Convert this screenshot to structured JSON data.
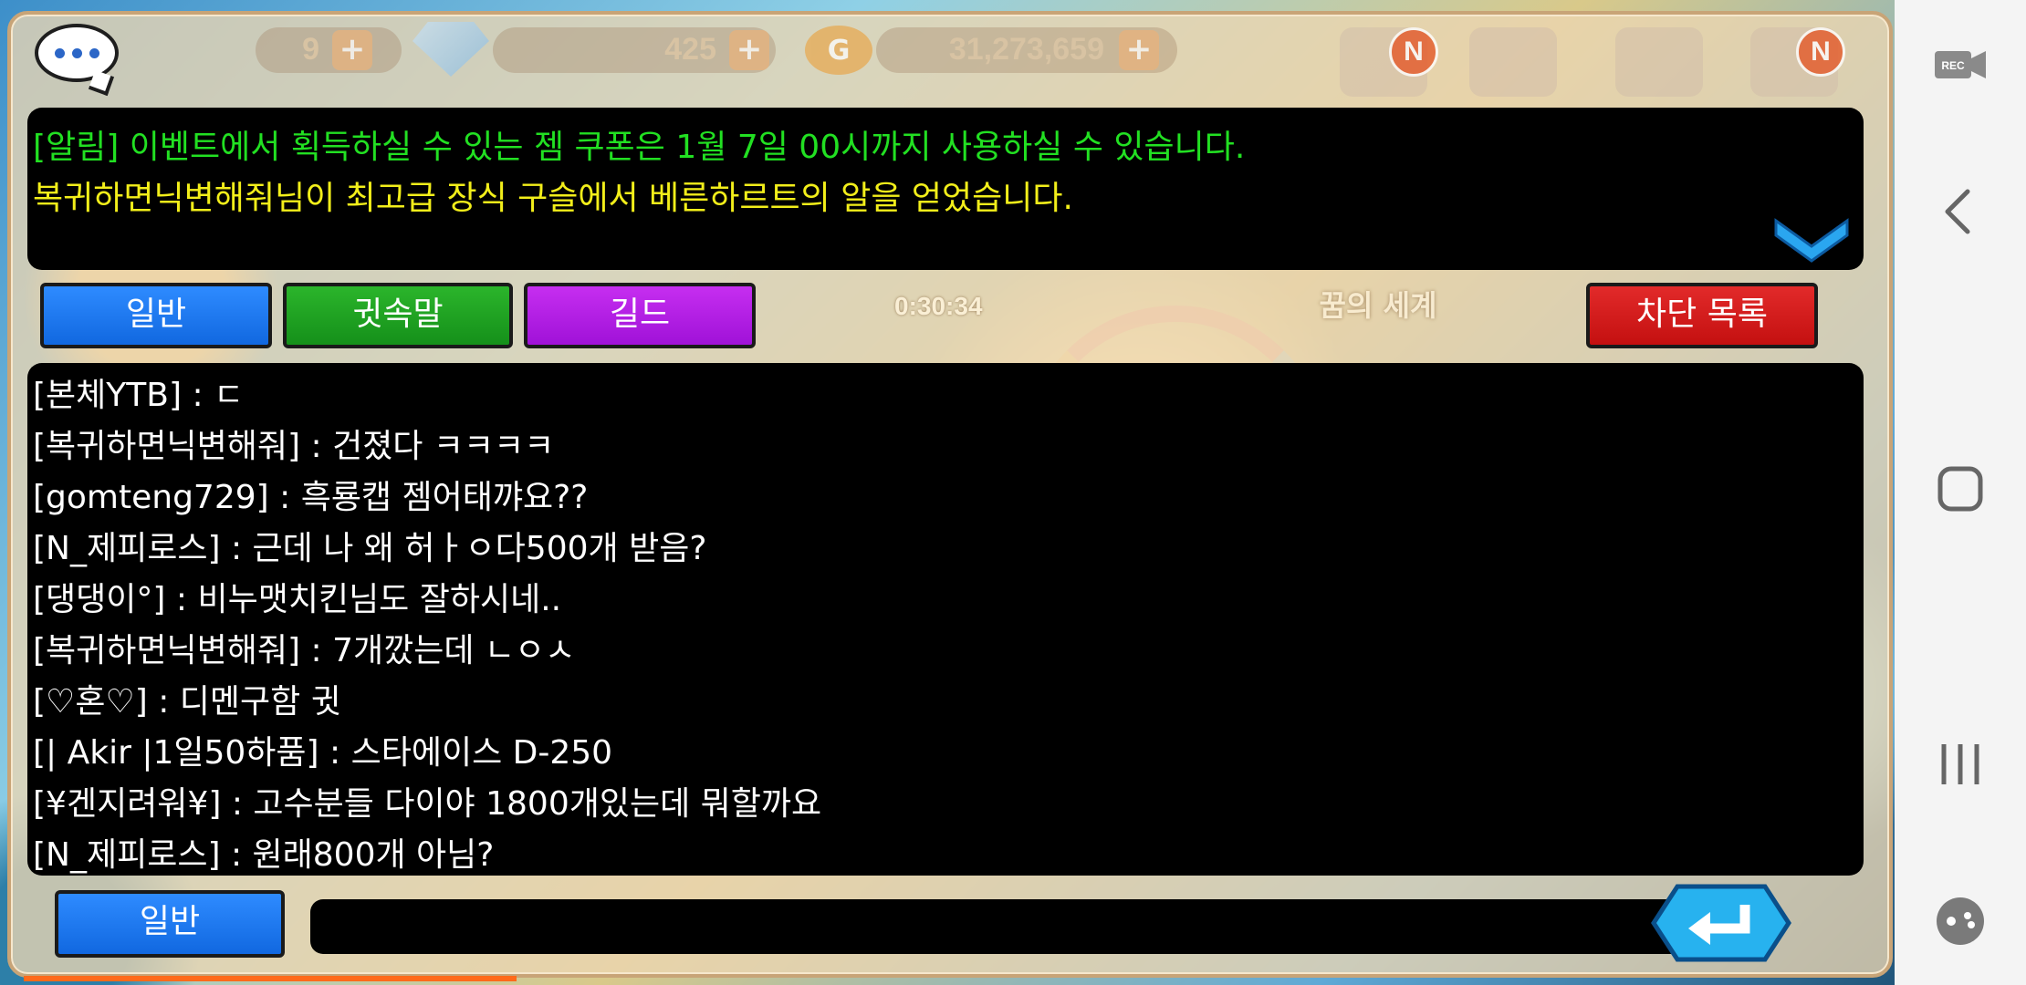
{
  "currency": {
    "hearts": "9",
    "gems": "425",
    "gold": "31,273,659",
    "plus_label": "+",
    "gold_icon_letter": "G"
  },
  "badges": {
    "mail": "N",
    "notice": "N"
  },
  "notice": {
    "line1": "[알림] 이벤트에서 획득하실 수 있는 젬 쿠폰은 1월 7일 00시까지 사용하실 수 있습니다.",
    "line2": "복귀하면닉변해줘님이 최고급 장식 구슬에서 베른하르트의 알을 얻었습니다."
  },
  "tabs": {
    "general": "일반",
    "whisper": "귓속말",
    "guild": "길드",
    "block_list": "차단 목록"
  },
  "background": {
    "timer": "0:30:34",
    "world_name": "꿈의 세계"
  },
  "chat": {
    "messages": [
      "[본체YTB] : ㄷ",
      "[복귀하면닉변해줘] : 건졌다 ㅋㅋㅋㅋ",
      "[gomteng729] : 흑룡캡 젬어태꺄요??",
      "[N_제피로스] : 근데 나 왜 허ㅏㅇ다500개 받음?",
      "[댕댕이°] : 비누맷치킨님도 잘하시네..",
      "[복귀하면닉변해줘] : 7개깠는데 ㄴㅇㅅ",
      "[♡혼♡] : 디멘구함 귓",
      "[| Akir |1일50하품] : 스타에이스 D-250",
      "[¥겐지려워¥] : 고수분들 다이야 1800개있는데 뭐할까요",
      "[N_제피로스] : 원래800개 아님?"
    ]
  },
  "input": {
    "channel": "일반",
    "value": ""
  },
  "colors": {
    "notice_green": "#22e022",
    "notice_yellow": "#f2ee1a",
    "tab_blue": "#1f7af0",
    "tab_green": "#1ea021",
    "tab_purple": "#b41ee4",
    "tab_red": "#d41c1c"
  },
  "icons": [
    "chat-bubble-icon",
    "gem-icon",
    "gold-coin-icon",
    "mail-icon",
    "shop-icon",
    "location-icon",
    "news-icon",
    "chevron-down-icon",
    "enter-icon",
    "record-icon",
    "back-icon",
    "home-icon",
    "recents-icon",
    "game-tools-icon"
  ]
}
